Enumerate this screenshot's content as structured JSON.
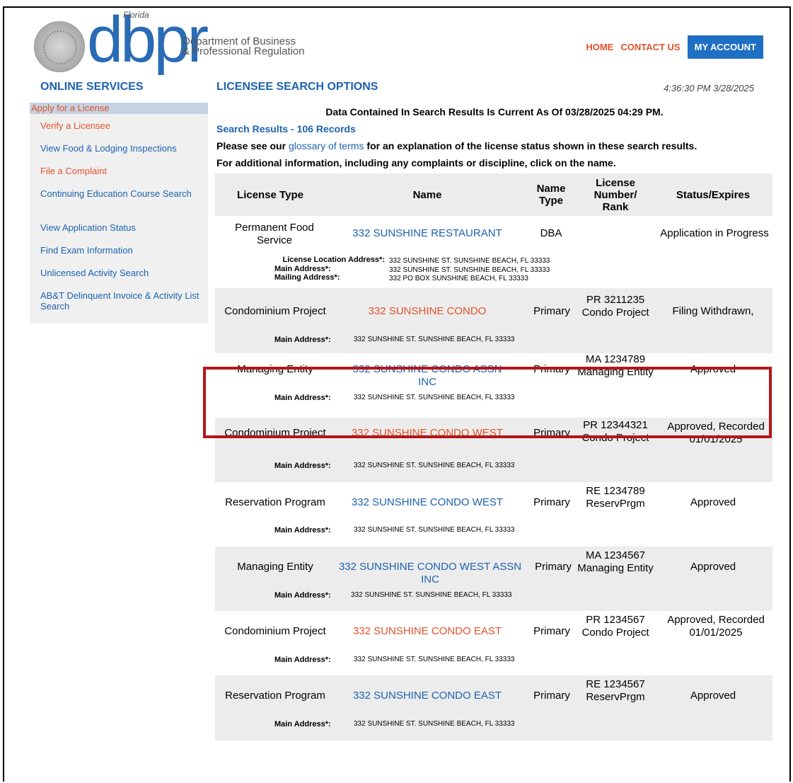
{
  "header": {
    "logo_florida": "Florida",
    "logo_text": "dbpr",
    "logo_dept_line1": "Department of Business",
    "logo_dept_line2": "& Professional Regulation",
    "nav_home": "HOME",
    "nav_contact": "CONTACT US",
    "nav_account": "MY ACCOUNT"
  },
  "sidebar": {
    "title": "ONLINE SERVICES",
    "items": [
      {
        "label": "Apply for a License"
      },
      {
        "label": "Verify a Licensee"
      },
      {
        "label": "View Food & Lodging Inspections"
      },
      {
        "label": "File a Complaint"
      },
      {
        "label": "Continuing Education Course Search"
      },
      {
        "label": "View Application Status"
      },
      {
        "label": "Find Exam Information"
      },
      {
        "label": "Unlicensed Activity Search"
      },
      {
        "label": "AB&T Delinquent Invoice & Activity List Search"
      }
    ]
  },
  "main": {
    "title": "LICENSEE SEARCH OPTIONS",
    "clock": "4:36:30 PM 3/28/2025",
    "current_as_of": "Data Contained In Search Results Is Current As Of 03/28/2025 04:29 PM.",
    "records": "Search Results - 106 Records",
    "glossary_pre": "Please see our ",
    "glossary_link": "glossary of terms",
    "glossary_post": " for an explanation of the license status shown in these search results.",
    "additional": "For additional information, including any complaints or discipline, click on the name."
  },
  "table": {
    "headers": {
      "license_type": "License Type",
      "name": "Name",
      "name_type": "Name Type",
      "license_number": "License Number/ Rank",
      "status": "Status/Expires"
    },
    "first_row": {
      "license_type": "Permanent Food Service",
      "name": "332 SUNSHINE RESTAURANT",
      "name_type": "DBA",
      "status": "Application in Progress",
      "loc_label": "License Location Address*:",
      "loc_value": "332 SUNSHINE ST. SUNSHINE BEACH, FL 33333",
      "main_label": "Main Address*:",
      "main_value": "332 SUNSHINE ST. SUNSHINE BEACH, FL 33333",
      "mail_label": "Mailing Address*:",
      "mail_value": "332 PO BOX  SUNSHINE BEACH, FL 33333"
    },
    "rows": [
      {
        "license_type": "Condominium Project",
        "name": "332 SUNSHINE CONDO",
        "name_type": "Primary",
        "number": "PR  3211235",
        "rank": "Condo Project",
        "status": "Filing Withdrawn,",
        "addr_label": "Main Address*:",
        "addr": "332 SUNSHINE ST. SUNSHINE BEACH, FL 33333"
      },
      {
        "license_type": "Managing Entity",
        "name": "332 SUNSHINE CONDO ASSN INC",
        "name_type": "Primary",
        "number": "MA  1234789",
        "rank": "Managing Entity",
        "status": "Approved",
        "addr_label": "Main Address*:",
        "addr": "332 SUNSHINE ST. SUNSHINE BEACH, FL 33333"
      },
      {
        "license_type": "Condominium Project",
        "name": "332 SUNSHINE CONDO WEST",
        "name_type": "Primary",
        "number": "PR  12344321",
        "rank": "Condo Project",
        "status": "Approved, Recorded 01/01/2025",
        "addr_label": "Main Address*:",
        "addr": "332 SUNSHINE ST. SUNSHINE BEACH, FL 33333"
      },
      {
        "license_type": "Reservation Program",
        "name": "332 SUNSHINE CONDO WEST",
        "name_type": "Primary",
        "number": "RE  1234789",
        "rank": "ReservPrgm",
        "status": "Approved",
        "addr_label": "Main Address*:",
        "addr": "332 SUNSHINE ST. SUNSHINE BEACH, FL 33333"
      },
      {
        "license_type": "Managing Entity",
        "name": "332 SUNSHINE CONDO WEST ASSN INC",
        "name_type": "Primary",
        "number": "MA  1234567",
        "rank": "Managing Entity",
        "status": "Approved",
        "addr_label": "Main Address*:",
        "addr": "332 SUNSHINE ST. SUNSHINE BEACH, FL 33333"
      },
      {
        "license_type": "Condominium Project",
        "name": "332 SUNSHINE CONDO EAST",
        "name_type": "Primary",
        "number": "PR  1234567",
        "rank": "Condo Project",
        "status": "Approved, Recorded 01/01/2025",
        "addr_label": "Main Address*:",
        "addr": "332 SUNSHINE ST. SUNSHINE BEACH, FL 33333"
      },
      {
        "license_type": "Reservation Program",
        "name": "332 SUNSHINE CONDO EAST",
        "name_type": "Primary",
        "number": "RE  1234567",
        "rank": "ReservPrgm",
        "status": "Approved",
        "addr_label": "Main Address*:",
        "addr": "332 SUNSHINE ST. SUNSHINE BEACH, FL 33333"
      }
    ]
  },
  "colors": {
    "blue": "#1d62b0",
    "orange": "#e4522b",
    "highlight": "#b2161c"
  }
}
